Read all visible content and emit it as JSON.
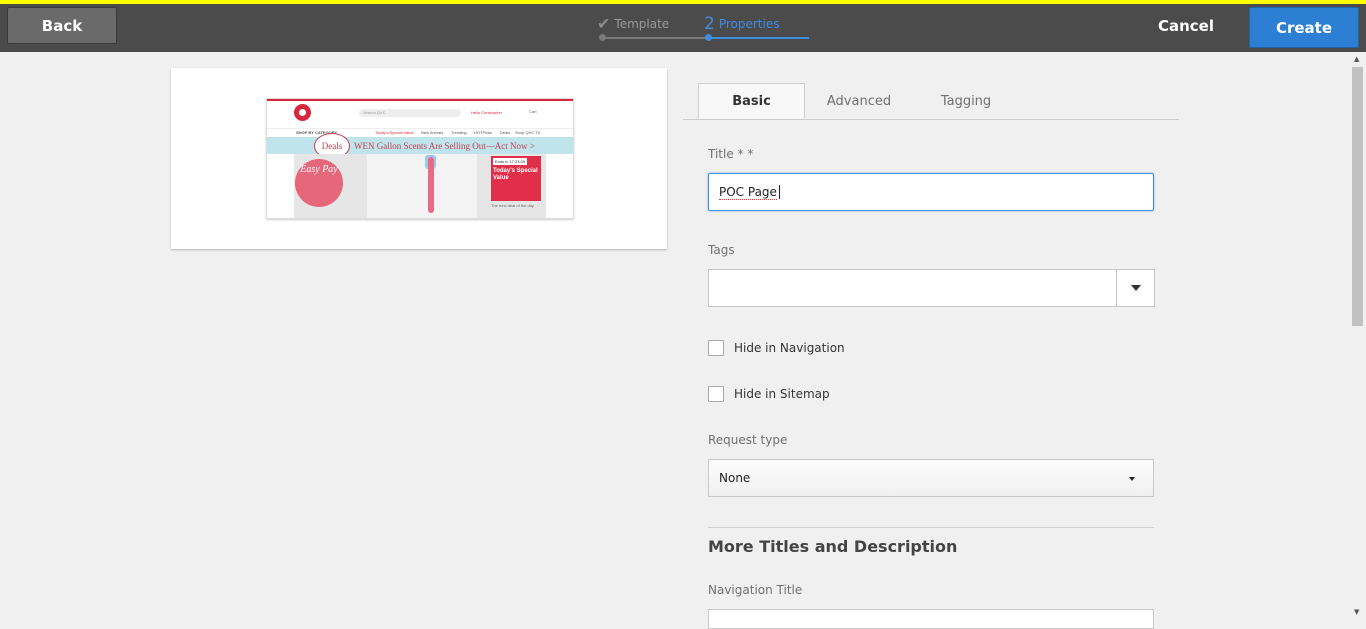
{
  "toolbar": {
    "back_label": "Back",
    "cancel_label": "Cancel",
    "create_label": "Create",
    "accent": "#2d7fd3",
    "highlight": "#ffff00"
  },
  "wizard": {
    "steps": [
      {
        "icon": "checkmark-icon",
        "label": "Template",
        "state": "done"
      },
      {
        "number": "2",
        "label": "Properties",
        "state": "active"
      }
    ]
  },
  "preview": {
    "search_placeholder": "Search QVC",
    "hello": "Hello Christopher",
    "cart": "Cart",
    "nav": [
      "SHOP BY CATEGORY",
      "Today's Special Value",
      "New Arrivals",
      "Trending",
      "HOTPicks",
      "Deals",
      "Shop QVC TV"
    ],
    "deals_badge": "Deals",
    "banner": "WEN Gallon Scents Are Selling Out—Act Now >",
    "easy_pay": "Easy Pay",
    "tsv_ends": "Ends in 17:23:09",
    "tsv_title": "Today's Special Value",
    "tsv_sub": "The best deal of the day"
  },
  "tabs": [
    "Basic",
    "Advanced",
    "Tagging"
  ],
  "form": {
    "title_label": "Title * *",
    "title_value": "POC Page",
    "tags_label": "Tags",
    "hide_nav_label": "Hide in Navigation",
    "hide_sitemap_label": "Hide in Sitemap",
    "request_type_label": "Request type",
    "request_type_value": "None",
    "section_heading": "More Titles and Description",
    "nav_title_label": "Navigation Title"
  }
}
